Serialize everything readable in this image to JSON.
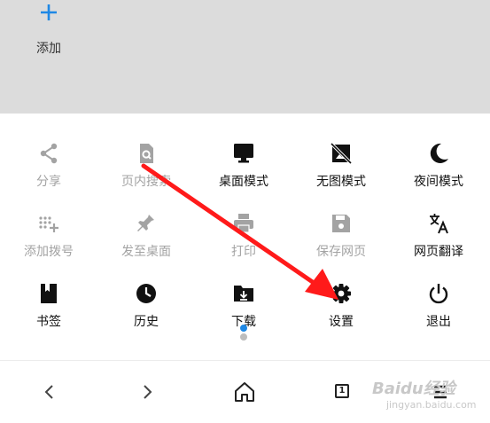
{
  "top": {
    "add_label": "添加"
  },
  "menu": {
    "share": "分享",
    "find_in_page": "页内搜索",
    "desktop_mode": "桌面模式",
    "no_image_mode": "无图模式",
    "night_mode": "夜间模式",
    "add_speed_dial": "添加拨号",
    "send_to_desktop": "发至桌面",
    "print": "打印",
    "save_page": "保存网页",
    "translate_page": "网页翻译",
    "bookmarks": "书签",
    "history": "历史",
    "downloads": "下载",
    "settings": "设置",
    "exit": "退出"
  },
  "bottom_bar": {
    "tab_count": "1"
  },
  "watermark": {
    "brand": "Baidu经验",
    "sub": "jingyan.baidu.com"
  },
  "colors": {
    "accent": "#1e88e5",
    "arrow": "#ff1a1a",
    "disabled": "#a3a3a3",
    "enabled": "#111111"
  }
}
